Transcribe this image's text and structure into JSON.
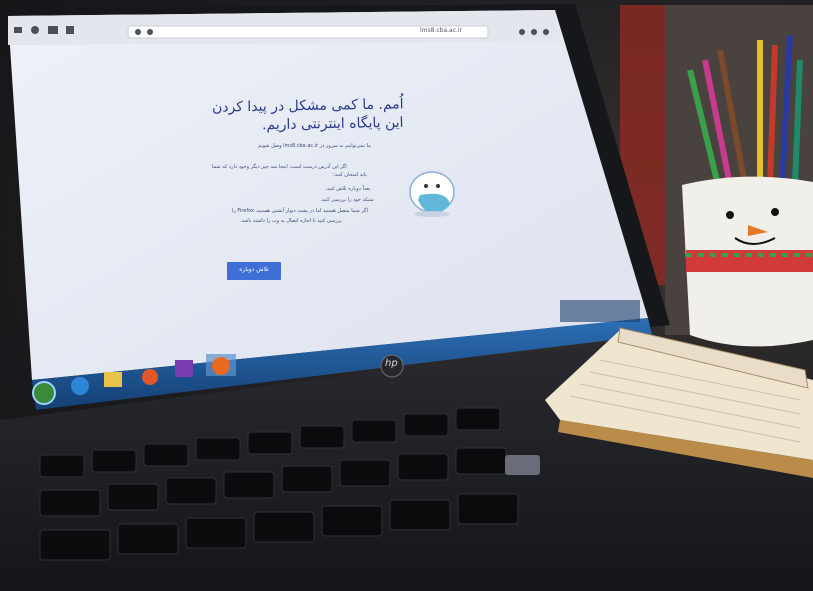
{
  "browser": {
    "url_text": "lms8.cba.ac.ir"
  },
  "error_page": {
    "title_line1": "اُمم. ما کمی مشکل در پیدا کردن",
    "title_line2": "این پایگاه اینترنتی داریم.",
    "subtitle": "ما نمی‌توانیم به سرور در lms8.cba.ac.ir وصل شویم",
    "intro_line1": "اگر این آدرس درست است، اینجا سه چیز دیگر وجود دارد که شما",
    "intro_line2": "باید امتحان کنید:",
    "bullets": [
      "بعداً دوباره تلاش کنید.",
      "شبکه خود را بررسی کنید.",
      "اگر شما متصل هستید اما در پشت دیوار آتشین هستید، Firefox را",
      "بررسی کنید تا اجازه اتصال به وب را داشته باشد."
    ],
    "retry_button": "تلاش دوباره"
  },
  "laptop": {
    "brand": "hp"
  },
  "colors": {
    "page_bg": "#f4f6fb",
    "title_text": "#24348f",
    "button_bg": "#3d6fd6",
    "taskbar": "#1d4f8a"
  }
}
